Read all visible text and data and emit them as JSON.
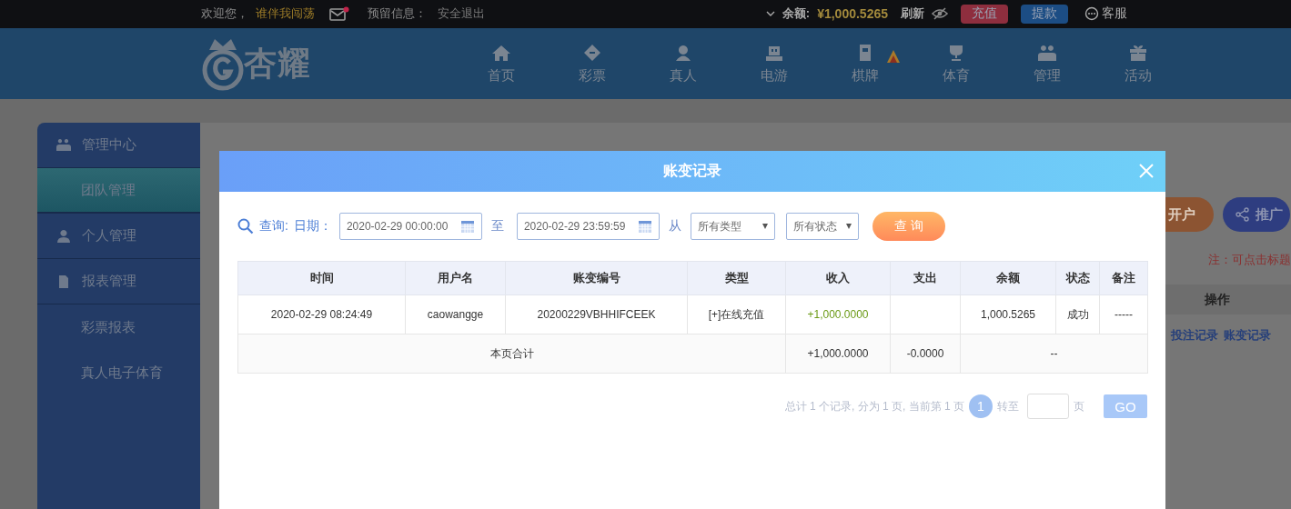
{
  "top_bar": {
    "greeting": "欢迎您，",
    "username": "谁伴我闯荡",
    "mail_unread": true,
    "reserved_info": "预留信息：",
    "logout": "安全退出",
    "balance_label": "余额:",
    "balance": "¥1,000.5265",
    "refresh": "刷新",
    "buttons": [
      {
        "label": "充值",
        "kind": "deposit"
      },
      {
        "label": "提款",
        "kind": "withdraw"
      }
    ],
    "service": "客服"
  },
  "nav": {
    "logo_text": "杏耀",
    "items": [
      {
        "label": "首页",
        "hot": false
      },
      {
        "label": "彩票",
        "hot": false
      },
      {
        "label": "真人",
        "hot": false
      },
      {
        "label": "电游",
        "hot": false
      },
      {
        "label": "棋牌",
        "hot": true
      },
      {
        "label": "体育",
        "hot": false
      },
      {
        "label": "管理",
        "hot": false
      },
      {
        "label": "活动",
        "hot": false
      }
    ]
  },
  "sidebar": {
    "items": [
      {
        "label": "管理中心",
        "children": [
          {
            "label": "团队管理",
            "selected": true
          }
        ]
      },
      {
        "label": "个人管理"
      },
      {
        "label": "报表管理",
        "children": [
          {
            "label": "彩票报表",
            "selected": false
          },
          {
            "label": "真人电子体育",
            "selected": false
          }
        ]
      }
    ]
  },
  "content": {
    "buttons": [
      "开户",
      "推广"
    ],
    "note": "注：可点击标题",
    "table_column": "操作",
    "links": [
      "投注记录",
      "账变记录"
    ]
  },
  "modal": {
    "title": "账变记录",
    "query": {
      "label": "查询:",
      "date_label": "日期：",
      "start": "2020-02-29 00:00:00",
      "to": "至",
      "end": "2020-02-29 23:59:59",
      "from": "从",
      "type_select": "所有类型",
      "status_select": "所有状态",
      "submit": "查 询"
    },
    "table": {
      "columns": [
        "时间",
        "用户名",
        "账变编号",
        "类型",
        "收入",
        "支出",
        "余额",
        "状态",
        "备注"
      ],
      "rows": [
        [
          "2020-02-29 08:24:49",
          "caowangge",
          "20200229VBHHIFCEEK",
          "[+]在线充值",
          "+1,000.0000",
          "",
          "1,000.5265",
          "成功",
          "-----"
        ]
      ],
      "total": {
        "label": "本页合计",
        "income": "+1,000.0000",
        "expense": "-0.0000",
        "rest": "--"
      }
    },
    "pagination": {
      "summary": "总计 1 个记录, 分为 1 页, 当前第 1 页",
      "pages": [
        {
          "label": "1",
          "selected": true
        }
      ],
      "goto_label": "转至",
      "page_unit": "页",
      "go": "GO"
    }
  }
}
